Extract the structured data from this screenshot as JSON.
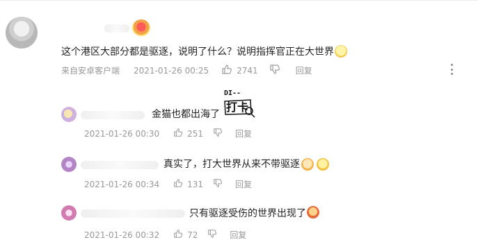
{
  "main_comment": {
    "text": "这个港区大部分都是驱逐，说明了什么？说明指挥官正在大世界",
    "source": "来自安卓客户端",
    "time": "2021-01-26 00:25",
    "likes": "2741",
    "reply_label": "回复"
  },
  "replies": [
    {
      "text": "金猫也都出海了",
      "time": "2021-01-26 00:30",
      "likes": "251",
      "reply_label": "回复"
    },
    {
      "text": "真实了，打大世界从来不带驱逐",
      "time": "2021-01-26 00:34",
      "likes": "131",
      "reply_label": "回复"
    },
    {
      "text": "只有驱逐受伤的世界出现了",
      "time": "2021-01-26 00:32",
      "likes": "72",
      "reply_label": "回复"
    }
  ],
  "sticker": {
    "top_text": "DI--",
    "main_text": "打卡"
  },
  "colors": {
    "text": "#222222",
    "meta": "#999999",
    "icon": "#9a9a9a"
  }
}
